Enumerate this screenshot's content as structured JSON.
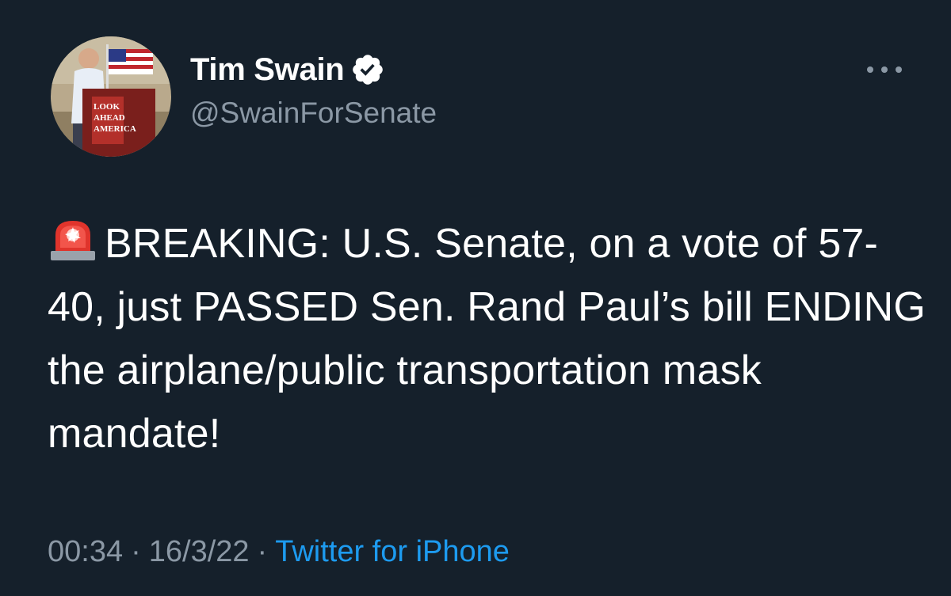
{
  "tweet": {
    "author": {
      "display_name": "Tim Swain",
      "handle": "@SwainForSenate",
      "verified": true,
      "avatar_podium_text": [
        "LOOK",
        "AHEAD",
        "AMERICA"
      ]
    },
    "more_icon": "more-horizontal-icon",
    "emoji": "police-car-light-icon",
    "text": "BREAKING: U.S. Senate, on a vote of 57-40, just PASSED Sen. Rand Paul’s bill ENDING the airplane/public transportation mask mandate!",
    "time": "00:34",
    "date": "16/3/22",
    "separator": "·",
    "source": "Twitter for iPhone"
  },
  "colors": {
    "background": "#15202b",
    "primary_text": "#ffffff",
    "secondary_text": "#8b98a5",
    "link": "#1d9bf0",
    "verified_badge": "#ffffff"
  }
}
